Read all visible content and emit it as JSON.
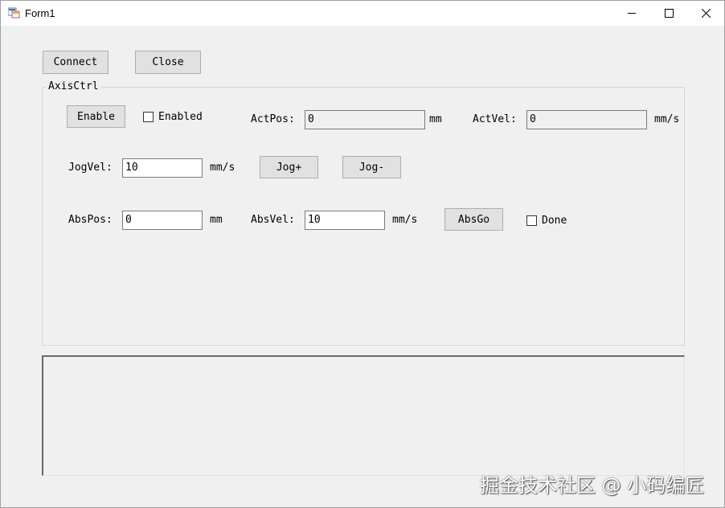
{
  "window": {
    "title": "Form1",
    "controls": {
      "minimize": "minimize-icon",
      "maximize": "maximize-icon",
      "close": "close-icon"
    }
  },
  "toolbar": {
    "connect_label": "Connect",
    "close_label": "Close"
  },
  "axis_ctrl": {
    "group_label": "AxisCtrl",
    "enable_label": "Enable",
    "enabled_label": "Enabled",
    "enabled_checked": false,
    "actpos_label": "ActPos:",
    "actpos_value": "0",
    "actpos_unit": "mm",
    "actvel_label": "ActVel:",
    "actvel_value": "0",
    "actvel_unit": "mm/s",
    "jogvel_label": "JogVel:",
    "jogvel_value": "10",
    "jogvel_unit": "mm/s",
    "jog_plus_label": "Jog+",
    "jog_minus_label": "Jog-",
    "abspos_label": "AbsPos:",
    "abspos_value": "0",
    "abspos_unit": "mm",
    "absvel_label": "AbsVel:",
    "absvel_value": "10",
    "absvel_unit": "mm/s",
    "absgo_label": "AbsGo",
    "done_label": "Done",
    "done_checked": false
  },
  "log": {
    "content": ""
  },
  "watermark": "掘金技术社区 @ 小码编匠",
  "colors": {
    "window_bg": "#f0f0f0",
    "button_bg": "#e1e1e1",
    "button_border": "#adadad",
    "textbox_border": "#7a7a7a"
  }
}
